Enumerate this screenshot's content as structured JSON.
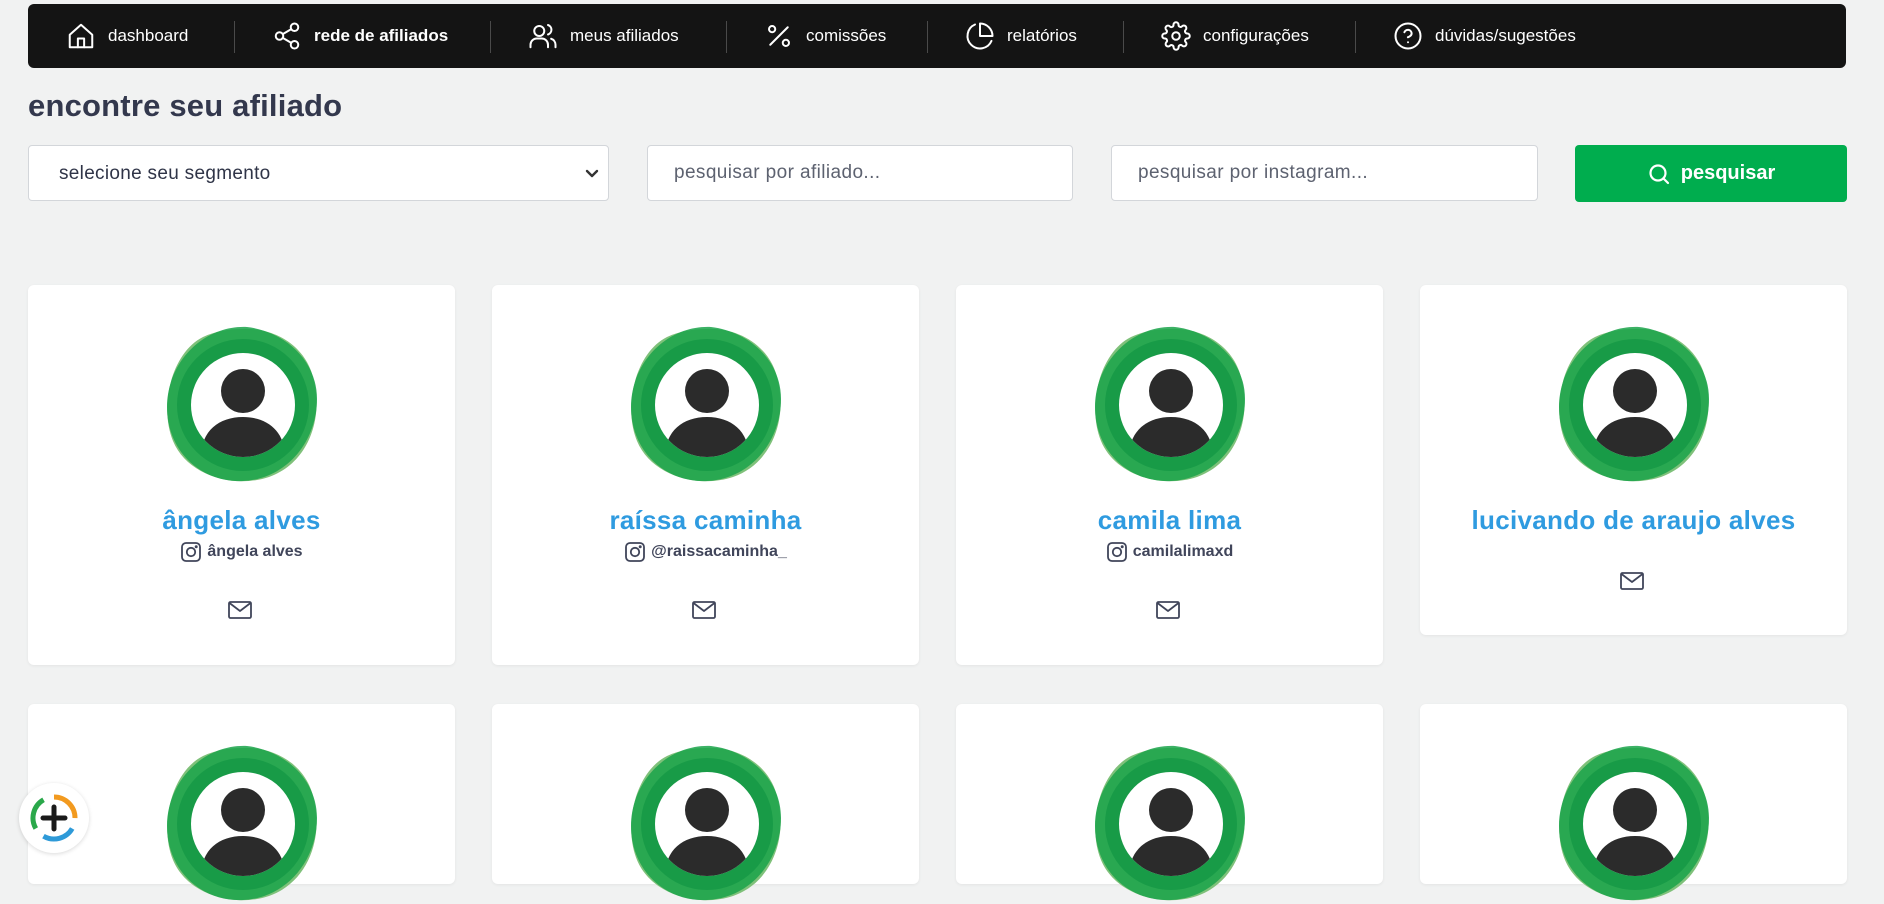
{
  "nav": {
    "items": [
      {
        "label": "dashboard",
        "icon": "home-icon"
      },
      {
        "label": "rede de afiliados",
        "icon": "share-icon",
        "active": true
      },
      {
        "label": "meus afiliados",
        "icon": "users-icon"
      },
      {
        "label": "comissões",
        "icon": "percent-icon"
      },
      {
        "label": "relatórios",
        "icon": "pie-chart-icon"
      },
      {
        "label": "configurações",
        "icon": "gear-icon"
      },
      {
        "label": "dúvidas/sugestões",
        "icon": "help-circle-icon"
      }
    ]
  },
  "page": {
    "title": "encontre seu afiliado"
  },
  "filters": {
    "segment_select": {
      "value": "selecione seu segmento"
    },
    "affiliate_search": {
      "placeholder": "pesquisar por afiliado..."
    },
    "instagram_search": {
      "placeholder": "pesquisar por instagram..."
    },
    "search_button": {
      "label": "pesquisar",
      "color": "#00ad4e"
    }
  },
  "affiliates": [
    {
      "name": "ângela alves",
      "instagram": "ângela alves"
    },
    {
      "name": "raíssa caminha",
      "instagram": "@raissacaminha_"
    },
    {
      "name": "camila lima",
      "instagram": "camilalimaxd"
    },
    {
      "name": "lucivando de araujo alves",
      "instagram": ""
    },
    {
      "name": "",
      "instagram": ""
    },
    {
      "name": "",
      "instagram": ""
    },
    {
      "name": "",
      "instagram": ""
    },
    {
      "name": "",
      "instagram": ""
    }
  ],
  "colors": {
    "nav_bg": "#141414",
    "page_bg": "#f1f2f2",
    "name_blue": "#2f9be0",
    "avatar_green": "#1aa34a"
  }
}
